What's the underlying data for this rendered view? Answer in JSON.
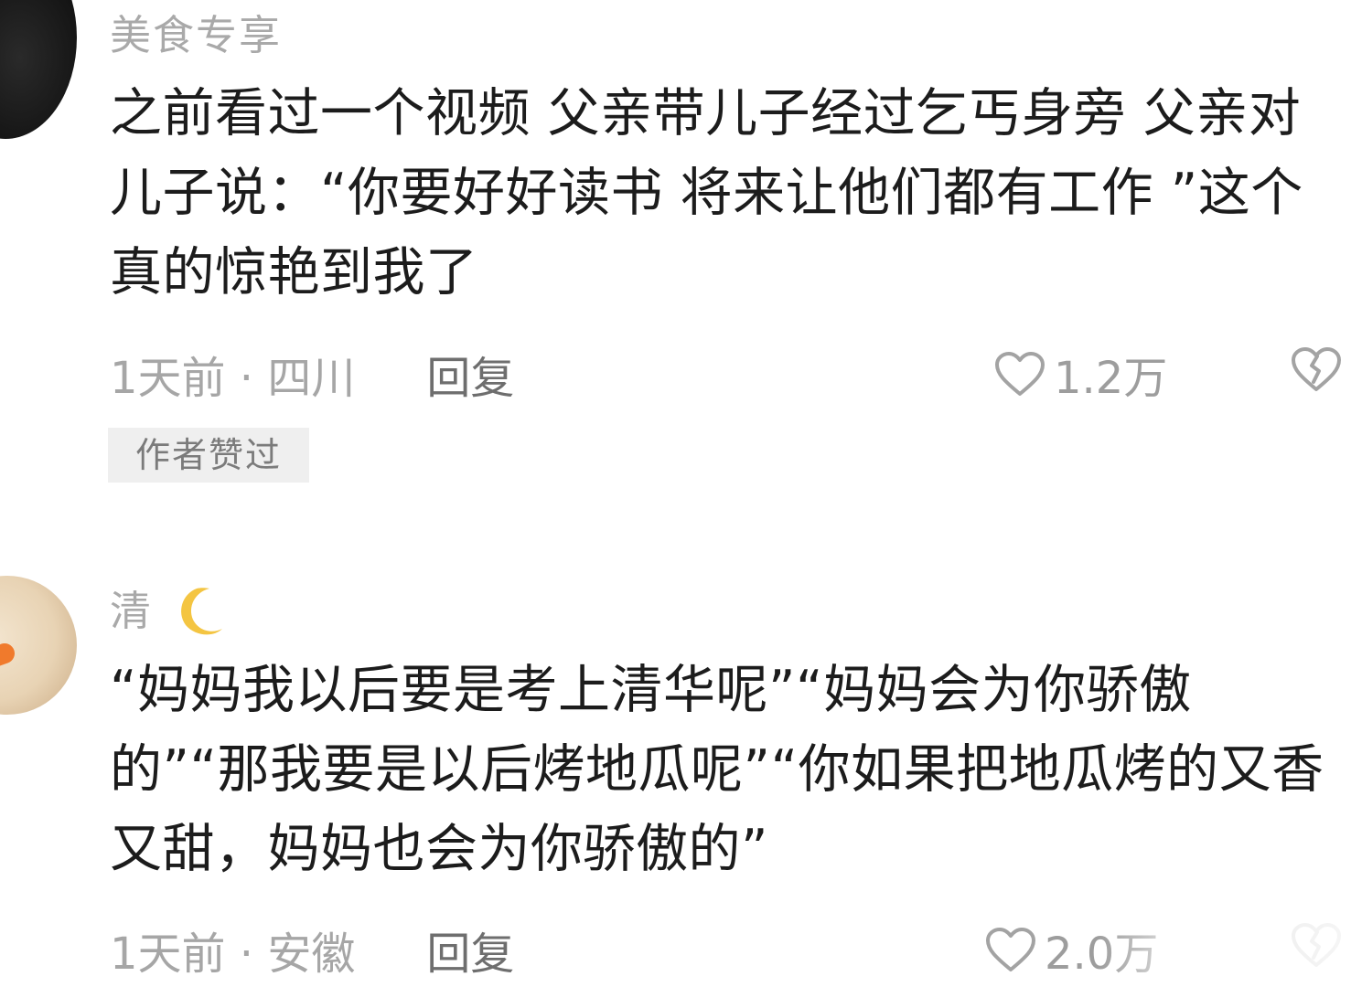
{
  "comments": [
    {
      "username": "美食专享",
      "text": "之前看过一个视频 父亲带儿子经过乞丐身旁 父亲对儿子说：“你要好好读书 将来让他们都有工作 ”这个真的惊艳到我了",
      "time_location": "1天前 · 四川",
      "reply_label": "回复",
      "like_count": "1.2万",
      "badge": "作者赞过"
    },
    {
      "username": "清",
      "username_icon": "crescent-moon-icon",
      "text": "“妈妈我以后要是考上清华呢”“妈妈会为你骄傲的”“那我要是以后烤地瓜呢”“你如果把地瓜烤的又香又甜，妈妈也会为你骄傲的”",
      "time_location": "1天前 · 安徽",
      "reply_label": "回复",
      "like_count": "2.0万"
    }
  ],
  "colors": {
    "username": "#a9a9a9",
    "content": "#1c1c1c",
    "meta": "#a6a6a6",
    "reply": "#6e6e6e",
    "badge_bg": "#efefef",
    "badge_text": "#7b7b7b",
    "moon": "#f4c542"
  }
}
